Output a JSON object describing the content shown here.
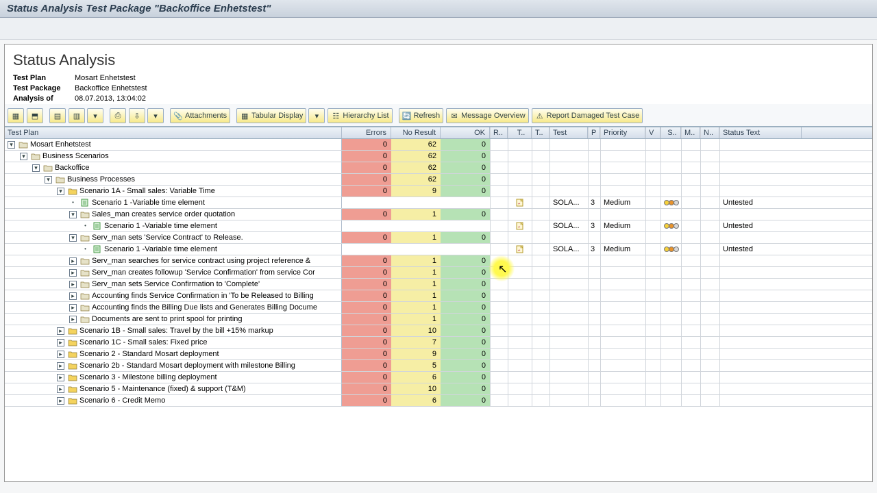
{
  "window_title": "Status Analysis Test Package \"Backoffice Enhetstest\"",
  "page_heading": "Status Analysis",
  "meta": {
    "plan_label": "Test Plan",
    "plan_value": "Mosart Enhetstest",
    "package_label": "Test Package",
    "package_value": "Backoffice Enhetstest",
    "analysis_label": "Analysis of",
    "analysis_value": "08.07.2013, 13:04:02"
  },
  "toolbar": {
    "attachments": "Attachments",
    "tabular": "Tabular Display",
    "hierarchy": "Hierarchy List",
    "refresh": "Refresh",
    "msg_overview": "Message Overview",
    "report_dmg": "Report Damaged Test Case"
  },
  "columns": {
    "tree": "Test Plan",
    "errors": "Errors",
    "nores": "No Result",
    "ok": "OK",
    "r": "R..",
    "t1": "T..",
    "t2": "T..",
    "test": "Test",
    "p": "P",
    "prio": "Priority",
    "v": "V",
    "s": "S..",
    "m": "M..",
    "n": "N..",
    "status": "Status Text"
  },
  "rows": [
    {
      "indent": 0,
      "expand": "open",
      "icon": "folder",
      "label": "Mosart Enhetstest",
      "errors": "0",
      "nores": "62",
      "ok": "0"
    },
    {
      "indent": 1,
      "expand": "open",
      "icon": "folder",
      "label": "Business Scenarios",
      "errors": "0",
      "nores": "62",
      "ok": "0"
    },
    {
      "indent": 2,
      "expand": "open",
      "icon": "folder",
      "label": "Backoffice",
      "errors": "0",
      "nores": "62",
      "ok": "0"
    },
    {
      "indent": 3,
      "expand": "open",
      "icon": "folder",
      "label": "Business Processes",
      "errors": "0",
      "nores": "62",
      "ok": "0"
    },
    {
      "indent": 4,
      "expand": "open",
      "icon": "folder-y",
      "label": "Scenario 1A - Small sales: Variable Time",
      "errors": "0",
      "nores": "9",
      "ok": "0"
    },
    {
      "indent": 5,
      "expand": "leaf",
      "icon": "leaf",
      "label": "Scenario 1 -Variable time element",
      "blank": true,
      "doc": true,
      "test": "SOLA...",
      "p": "3",
      "prio": "Medium",
      "traffic": true,
      "status": "Untested"
    },
    {
      "indent": 5,
      "expand": "open",
      "icon": "folder",
      "label": "Sales_man creates service order quotation",
      "errors": "0",
      "nores": "1",
      "ok": "0"
    },
    {
      "indent": 6,
      "expand": "leaf",
      "icon": "leaf",
      "label": "Scenario 1 -Variable time element",
      "blank": true,
      "doc": true,
      "test": "SOLA...",
      "p": "3",
      "prio": "Medium",
      "traffic": true,
      "status": "Untested"
    },
    {
      "indent": 5,
      "expand": "open",
      "icon": "folder",
      "label": "Serv_man sets 'Service Contract' to Release.",
      "errors": "0",
      "nores": "1",
      "ok": "0"
    },
    {
      "indent": 6,
      "expand": "leaf",
      "icon": "leaf",
      "label": "Scenario 1 -Variable time element",
      "blank": true,
      "doc": true,
      "test": "SOLA...",
      "p": "3",
      "prio": "Medium",
      "traffic": true,
      "status": "Untested"
    },
    {
      "indent": 5,
      "expand": "closed",
      "icon": "folder",
      "label": "Serv_man searches for service contract using project reference &",
      "errors": "0",
      "nores": "1",
      "ok": "0"
    },
    {
      "indent": 5,
      "expand": "closed",
      "icon": "folder",
      "label": "Serv_man creates followup 'Service Confirmation' from service Cor",
      "errors": "0",
      "nores": "1",
      "ok": "0"
    },
    {
      "indent": 5,
      "expand": "closed",
      "icon": "folder",
      "label": "Serv_man sets Service Confirmation to 'Complete'",
      "errors": "0",
      "nores": "1",
      "ok": "0"
    },
    {
      "indent": 5,
      "expand": "closed",
      "icon": "folder",
      "label": "Accounting finds Service Confirmation in 'To be Released to Billing",
      "errors": "0",
      "nores": "1",
      "ok": "0"
    },
    {
      "indent": 5,
      "expand": "closed",
      "icon": "folder",
      "label": "Accounting finds the Billing Due lists and Generates Billing Docume",
      "errors": "0",
      "nores": "1",
      "ok": "0"
    },
    {
      "indent": 5,
      "expand": "closed",
      "icon": "folder",
      "label": "Documents are sent to print spool for printing",
      "errors": "0",
      "nores": "1",
      "ok": "0"
    },
    {
      "indent": 4,
      "expand": "closed",
      "icon": "folder-y",
      "label": "Scenario 1B - Small sales: Travel by the bill +15% markup",
      "errors": "0",
      "nores": "10",
      "ok": "0"
    },
    {
      "indent": 4,
      "expand": "closed",
      "icon": "folder-y",
      "label": "Scenario 1C - Small sales: Fixed price",
      "errors": "0",
      "nores": "7",
      "ok": "0"
    },
    {
      "indent": 4,
      "expand": "closed",
      "icon": "folder-y",
      "label": "Scenario 2 - Standard Mosart deployment",
      "errors": "0",
      "nores": "9",
      "ok": "0"
    },
    {
      "indent": 4,
      "expand": "closed",
      "icon": "folder-y",
      "label": "Scenario 2b - Standard Mosart deployment with milestone Billing",
      "errors": "0",
      "nores": "5",
      "ok": "0"
    },
    {
      "indent": 4,
      "expand": "closed",
      "icon": "folder-y",
      "label": "Scenario 3 - Milestone billing deployment",
      "errors": "0",
      "nores": "6",
      "ok": "0"
    },
    {
      "indent": 4,
      "expand": "closed",
      "icon": "folder-y",
      "label": "Scenario 5 - Maintenance (fixed) & support (T&M)",
      "errors": "0",
      "nores": "10",
      "ok": "0"
    },
    {
      "indent": 4,
      "expand": "closed",
      "icon": "folder-y",
      "label": "Scenario 6 - Credit Memo",
      "errors": "0",
      "nores": "6",
      "ok": "0"
    }
  ]
}
